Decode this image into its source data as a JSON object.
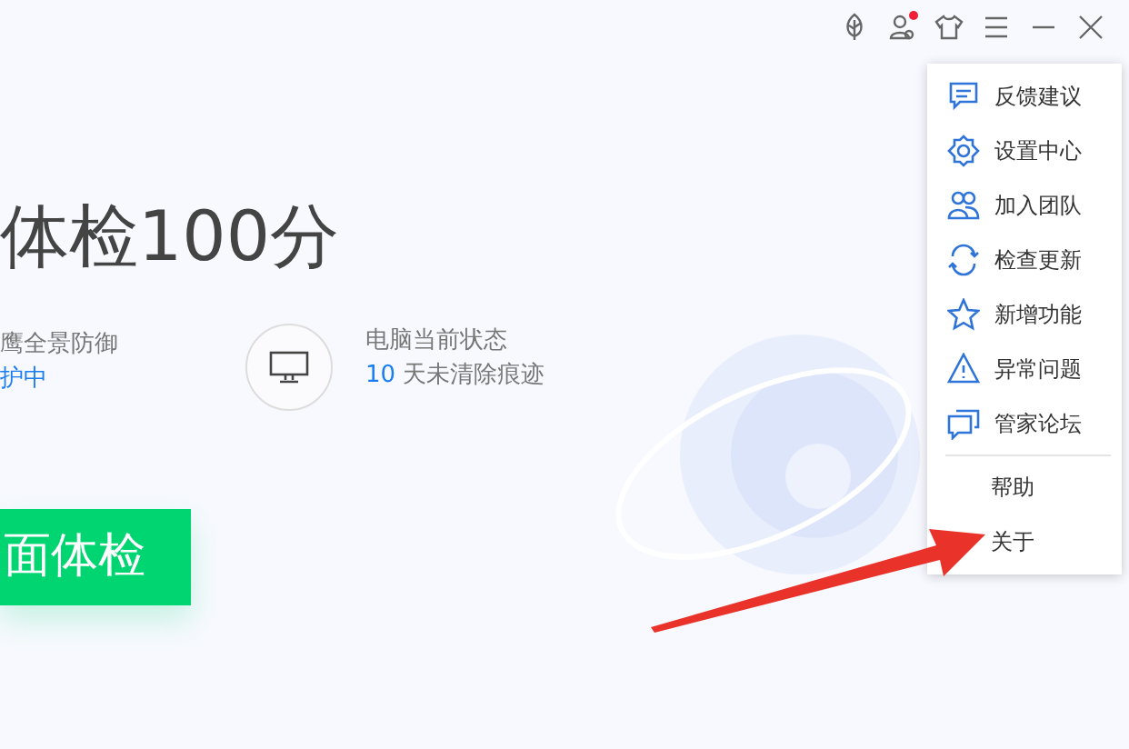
{
  "title_bar": {
    "notification_dot": true
  },
  "headline": "体检100分",
  "status_items": [
    {
      "label": "鹰全景防御",
      "value": "护中"
    },
    {
      "label": "电脑当前状态",
      "count": "10",
      "value": "天未清除痕迹"
    }
  ],
  "scan_button": "面体检",
  "menu": {
    "items": [
      "反馈建议",
      "设置中心",
      "加入团队",
      "检查更新",
      "新增功能",
      "异常问题",
      "管家论坛"
    ],
    "footer_items": [
      "帮助",
      "关于"
    ]
  }
}
